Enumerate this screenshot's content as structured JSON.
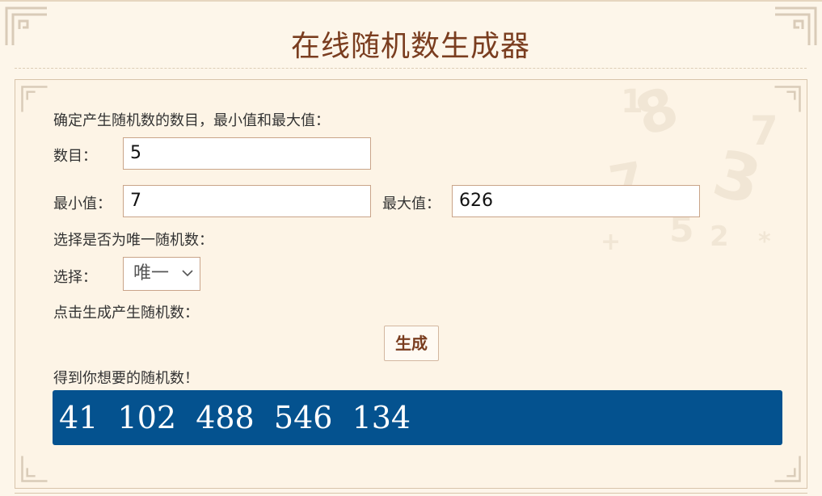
{
  "page": {
    "title": "在线随机数生成器"
  },
  "form": {
    "intro": "确定产生随机数的数目，最小值和最大值：",
    "count_label": "数目：",
    "count_value": "5",
    "min_label": "最小值：",
    "min_value": "7",
    "max_label": "最大值：",
    "max_value": "626",
    "unique_prompt": "选择是否为唯一随机数：",
    "select_label": "选择：",
    "select_value": "唯一",
    "generate_prompt": "点击生成产生随机数：",
    "generate_button": "生成",
    "result_label": "得到你想要的随机数！"
  },
  "result": {
    "numbers": [
      "41",
      "102",
      "488",
      "546",
      "134"
    ],
    "display": "41  102  488  546  134"
  },
  "colors": {
    "background": "#fdf6ea",
    "title": "#7a3d1f",
    "result_bg": "#04528f",
    "border": "#d8c4ab"
  },
  "icons": [
    "corner-ornament-icon",
    "chevron-down-icon"
  ]
}
